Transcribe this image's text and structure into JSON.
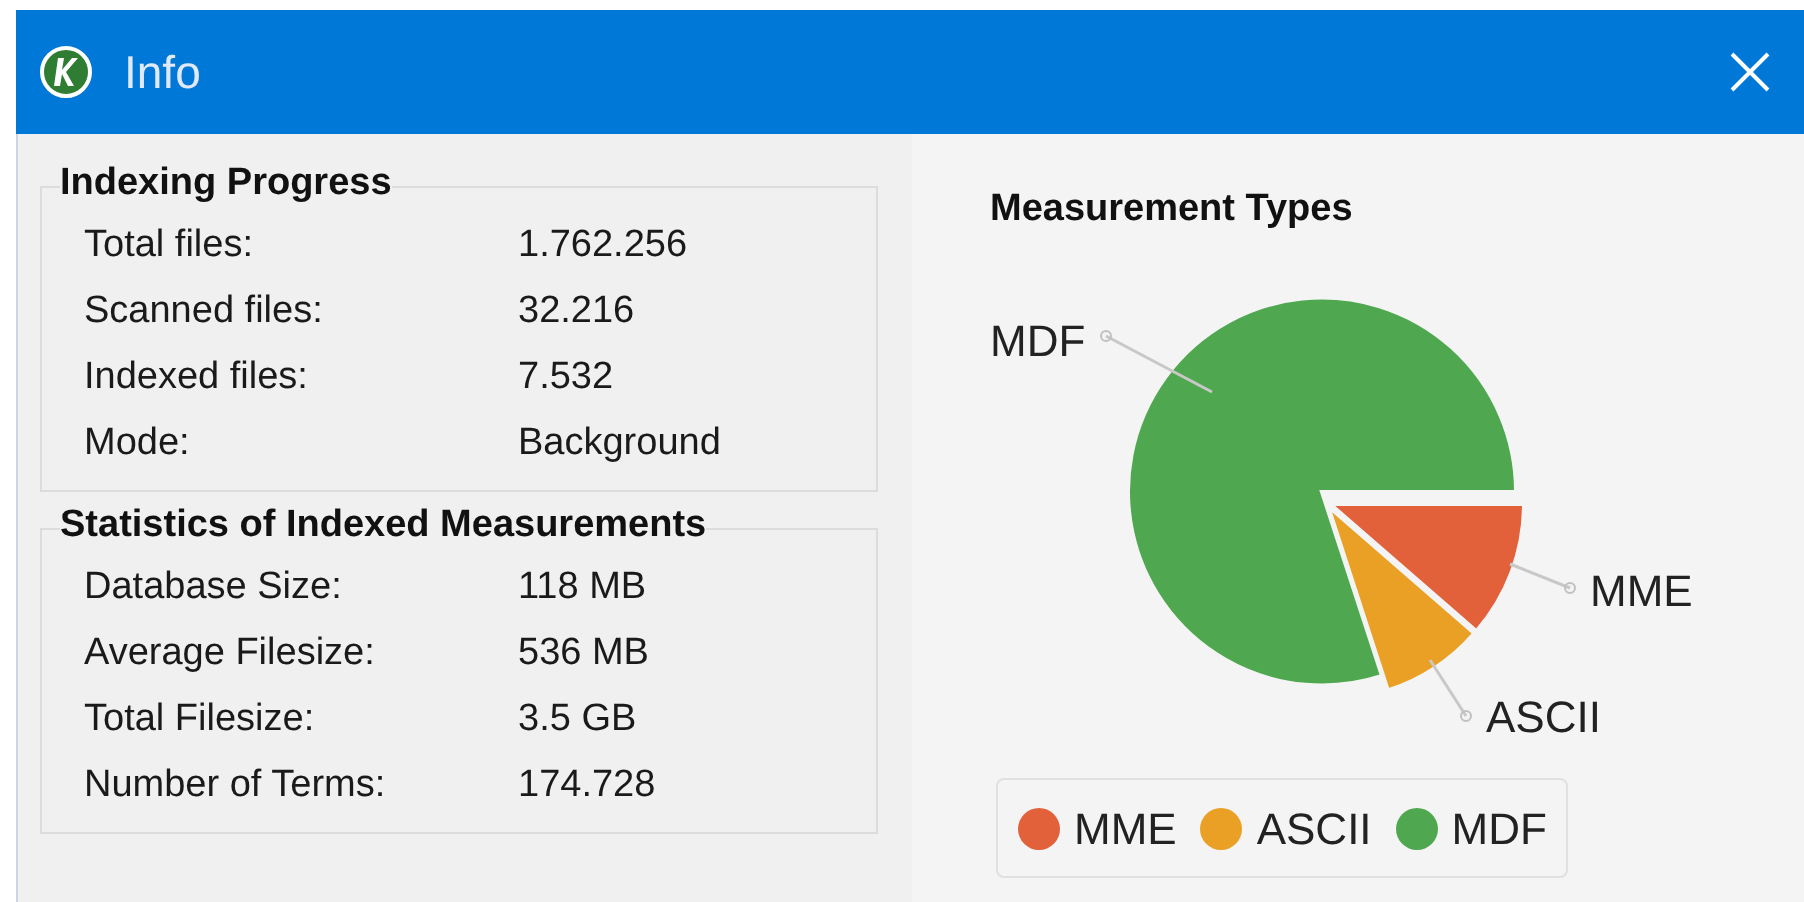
{
  "window": {
    "title": "Info"
  },
  "groups": [
    {
      "title": "Indexing Progress",
      "rows": [
        {
          "label": "Total files:",
          "value": "1.762.256"
        },
        {
          "label": "Scanned files:",
          "value": "32.216"
        },
        {
          "label": "Indexed files:",
          "value": "7.532"
        },
        {
          "label": "Mode:",
          "value": "Background"
        }
      ]
    },
    {
      "title": "Statistics of Indexed Measurements",
      "rows": [
        {
          "label": "Database Size:",
          "value": "118 MB"
        },
        {
          "label": "Average Filesize:",
          "value": "536 MB"
        },
        {
          "label": "Total Filesize:",
          "value": "3.5 GB"
        },
        {
          "label": "Number of Terms:",
          "value": "174.728"
        }
      ]
    }
  ],
  "chart": {
    "title": "Measurement Types",
    "slices": [
      {
        "label": "MDF",
        "color": "#4fa84f"
      },
      {
        "label": "MME",
        "color": "#e2603a"
      },
      {
        "label": "ASCII",
        "color": "#e9a024"
      }
    ],
    "legend": [
      {
        "label": "MME",
        "color": "#e2603a"
      },
      {
        "label": "ASCII",
        "color": "#e9a024"
      },
      {
        "label": "MDF",
        "color": "#4fa84f"
      }
    ]
  }
}
